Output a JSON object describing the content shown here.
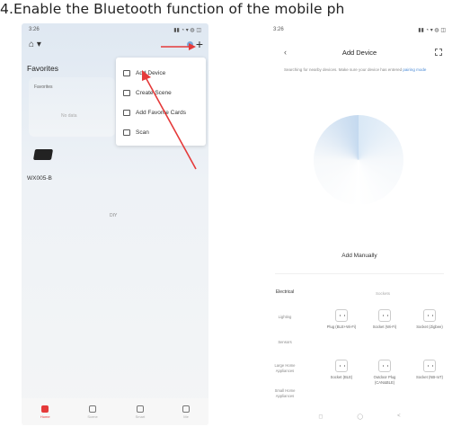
{
  "caption": "4.Enable the Bluetooth function of  the mobile ph",
  "left_phone": {
    "status": {
      "time": "3:26",
      "icons": "▮▮ ◔ ▾ ◍ ◫"
    },
    "favorites_title": "Favorites",
    "fav_card": {
      "label": "Favorites",
      "sub": "No data"
    },
    "device_name": "WX005-B",
    "diy_label": "DIY",
    "menu": [
      {
        "label": "Add Device",
        "icon": "monitor-icon"
      },
      {
        "label": "Create Scene",
        "icon": "edit-icon"
      },
      {
        "label": "Add Favorite Cards",
        "icon": "card-icon"
      },
      {
        "label": "Scan",
        "icon": "scan-icon"
      }
    ],
    "tabs": [
      "Home",
      "Scene",
      "Smart",
      "Me"
    ]
  },
  "right_phone": {
    "status": {
      "time": "3:26",
      "icons": "▮▮ ◔ ▾ ◍ ◫"
    },
    "title": "Add Device",
    "notice_text": "Searching for nearby devices. Make sure your device has entered ",
    "notice_link": "pairing mode",
    "add_manually": "Add Manually",
    "top_category": "Sockets",
    "categories": [
      "Electrical",
      "Lighting",
      "Sensors",
      "Large Home Appliances",
      "Small Home Appliances"
    ],
    "devices": [
      {
        "name": "Plug (BLE+Wi-Fi)"
      },
      {
        "name": "Socket (Wi-Fi)"
      },
      {
        "name": "Socket (Zigbee)"
      },
      {
        "name": "Socket (BLE)"
      },
      {
        "name": "Outdoor Plug (CAN&BLE)"
      },
      {
        "name": "Socket (NB-IoT)"
      }
    ],
    "nav": [
      "◻",
      "◯",
      "<"
    ]
  },
  "colors": {
    "accent_red": "#e53a3a",
    "link_blue": "#4a8ad6"
  }
}
